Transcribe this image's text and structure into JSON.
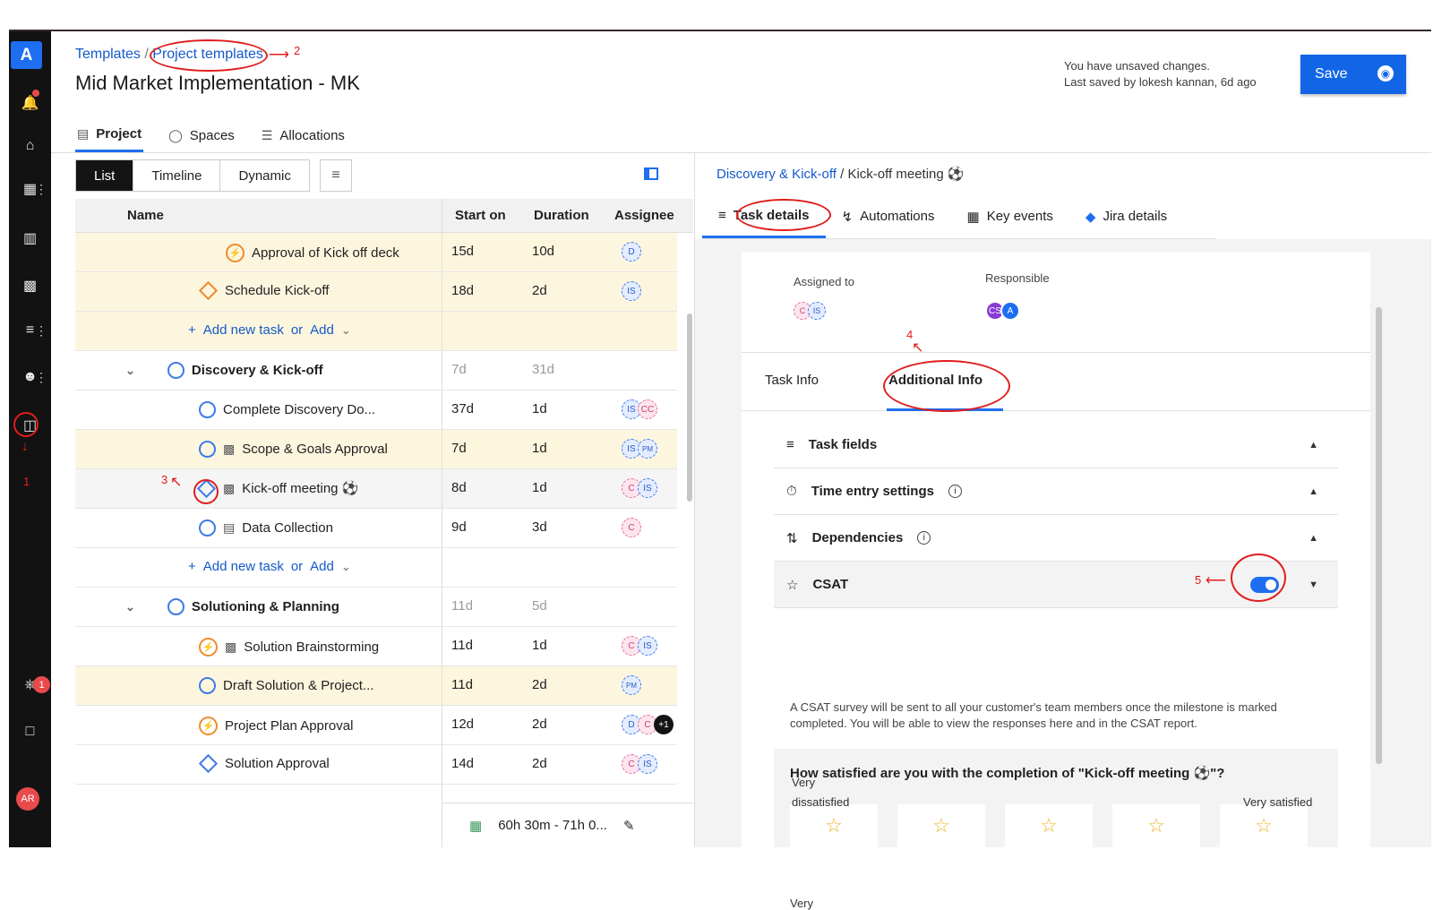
{
  "breadcrumb": {
    "root": "Templates",
    "sep": "/",
    "current": "Project templates"
  },
  "page_title": "Mid Market Implementation - MK",
  "unsaved": {
    "line1": "You have unsaved changes.",
    "line2": "Last saved by lokesh kannan, 6d ago"
  },
  "save_label": "Save",
  "main_tabs": [
    {
      "label": "Project"
    },
    {
      "label": "Spaces"
    },
    {
      "label": "Allocations"
    }
  ],
  "view_tabs": [
    {
      "label": "List"
    },
    {
      "label": "Timeline"
    },
    {
      "label": "Dynamic"
    }
  ],
  "columns": {
    "name": "Name",
    "start": "Start on",
    "duration": "Duration",
    "assignee": "Assignee"
  },
  "rows": [
    {
      "name": "Approval of Kick off deck",
      "start": "15d",
      "duration": "10d"
    },
    {
      "name": "Schedule Kick-off",
      "start": "18d",
      "duration": "2d"
    },
    {
      "add": "Add new task",
      "or": "or",
      "add2": "Add"
    },
    {
      "name": "Discovery & Kick-off",
      "start": "7d",
      "duration": "31d"
    },
    {
      "name": "Complete Discovery Do...",
      "start": "37d",
      "duration": "1d"
    },
    {
      "name": "Scope & Goals Approval",
      "start": "7d",
      "duration": "1d"
    },
    {
      "name": "Kick-off meeting ⚽",
      "start": "8d",
      "duration": "1d"
    },
    {
      "name": "Data Collection",
      "start": "9d",
      "duration": "3d"
    },
    {
      "add": "Add new task",
      "or": "or",
      "add2": "Add"
    },
    {
      "name": "Solutioning & Planning",
      "start": "11d",
      "duration": "5d"
    },
    {
      "name": "Solution Brainstorming",
      "start": "11d",
      "duration": "1d"
    },
    {
      "name": "Draft Solution & Project...",
      "start": "11d",
      "duration": "2d"
    },
    {
      "name": "Project Plan Approval",
      "start": "12d",
      "duration": "2d"
    },
    {
      "name": "Solution Approval",
      "start": "14d",
      "duration": "2d"
    }
  ],
  "badges": {
    "d": "D",
    "is": "IS",
    "c": "C",
    "cc": "CC",
    "pm": "PM",
    "plus1": "+1",
    "cs": "CS",
    "a": "A"
  },
  "footer_time": "60h 30m - 71h 0...",
  "right": {
    "crumb_parent": "Discovery & Kick-off",
    "crumb_sep": "/",
    "crumb_current": "Kick-off meeting ⚽",
    "tabs": [
      {
        "label": "Task details"
      },
      {
        "label": "Automations"
      },
      {
        "label": "Key events"
      },
      {
        "label": "Jira details"
      }
    ],
    "assigned_to": "Assigned to",
    "responsible": "Responsible",
    "content_tabs": [
      {
        "label": "Task Info"
      },
      {
        "label": "Additional Info"
      }
    ],
    "sections": [
      {
        "label": "Task fields"
      },
      {
        "label": "Time entry settings"
      },
      {
        "label": "Dependencies"
      },
      {
        "label": "CSAT"
      }
    ],
    "csat_enabled": true,
    "csat_desc": "A CSAT survey will be sent to all your customer's team members once the milestone is marked completed. You will be able to view the responses here and in the CSAT report.",
    "question": "How satisfied are you with the completion of \"Kick-off meeting ⚽\"?",
    "low_label_1": "Very",
    "low_label_2": "dissatisfied",
    "high_label": "Very satisfied"
  },
  "annotations": {
    "a1": "1",
    "a2": "2",
    "a3": "3",
    "a4": "4",
    "a5": "5"
  },
  "notif_count": "1",
  "avatar": "AR",
  "logo": "A",
  "colors": {
    "accent": "#1e6ef1",
    "annotation": "#e01d1d",
    "highlight_row": "#fdf6df",
    "rail": "#121212"
  }
}
